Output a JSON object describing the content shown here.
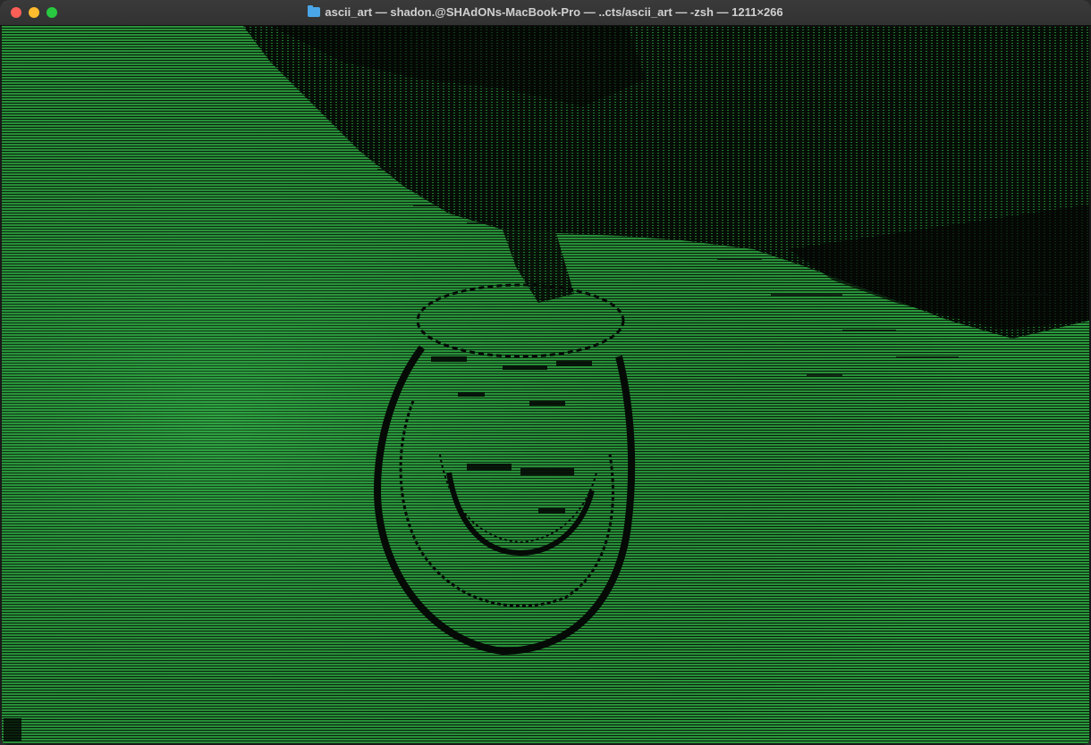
{
  "window": {
    "title": "ascii_art — shadon.@SHAdONs-MacBook-Pro — ..cts/ascii_art — -zsh — 1211×266",
    "title_icon": "folder-icon"
  },
  "terminal": {
    "content": "ascii-art-render",
    "colors": {
      "foreground": "#2aa640",
      "background": "#000000"
    }
  }
}
